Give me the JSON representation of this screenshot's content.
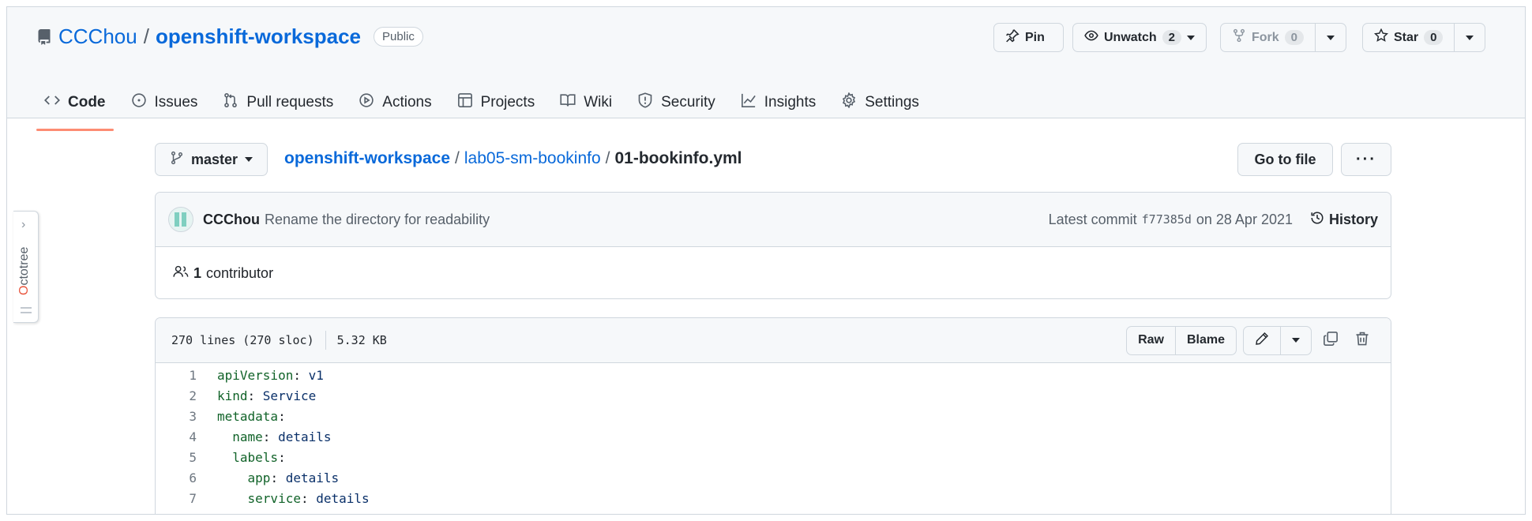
{
  "repo": {
    "owner": "CCChou",
    "separator": "/",
    "name": "openshift-workspace",
    "visibility": "Public"
  },
  "actions": {
    "pin": "Pin",
    "unwatch": "Unwatch",
    "unwatch_count": "2",
    "fork": "Fork",
    "fork_count": "0",
    "star": "Star",
    "star_count": "0"
  },
  "nav": {
    "items": [
      {
        "label": "Code",
        "icon": "code-icon"
      },
      {
        "label": "Issues",
        "icon": "issue-icon"
      },
      {
        "label": "Pull requests",
        "icon": "pull-request-icon"
      },
      {
        "label": "Actions",
        "icon": "play-icon"
      },
      {
        "label": "Projects",
        "icon": "table-icon"
      },
      {
        "label": "Wiki",
        "icon": "book-icon"
      },
      {
        "label": "Security",
        "icon": "shield-icon"
      },
      {
        "label": "Insights",
        "icon": "graph-icon"
      },
      {
        "label": "Settings",
        "icon": "gear-icon"
      }
    ]
  },
  "branch": {
    "name": "master"
  },
  "breadcrumb": {
    "root": "openshift-workspace",
    "dir": "lab05-sm-bookinfo",
    "file": "01-bookinfo.yml",
    "sep": "/"
  },
  "file_nav": {
    "goto": "Go to file",
    "more": "···"
  },
  "commit": {
    "author": "CCChou",
    "message": "Rename the directory for readability",
    "latest_label": "Latest commit",
    "sha": "f77385d",
    "date": "on 28 Apr 2021",
    "history": "History"
  },
  "contributors": {
    "count": "1",
    "label": "contributor"
  },
  "file": {
    "lines": "270 lines (270 sloc)",
    "size": "5.32 KB",
    "raw": "Raw",
    "blame": "Blame"
  },
  "code": [
    {
      "n": "1",
      "indent": "",
      "key": "apiVersion",
      "val": "v1"
    },
    {
      "n": "2",
      "indent": "",
      "key": "kind",
      "val": "Service"
    },
    {
      "n": "3",
      "indent": "",
      "key": "metadata",
      "val": ""
    },
    {
      "n": "4",
      "indent": "  ",
      "key": "name",
      "val": "details"
    },
    {
      "n": "5",
      "indent": "  ",
      "key": "labels",
      "val": ""
    },
    {
      "n": "6",
      "indent": "    ",
      "key": "app",
      "val": "details"
    },
    {
      "n": "7",
      "indent": "    ",
      "key": "service",
      "val": "details"
    }
  ],
  "octotree": {
    "first_letter": "O",
    "rest": "ctotree"
  },
  "colors": {
    "link": "#0969da",
    "active_tab_underline": "#fd8c73",
    "yaml_key": "#116329",
    "yaml_value": "#0a3069"
  }
}
